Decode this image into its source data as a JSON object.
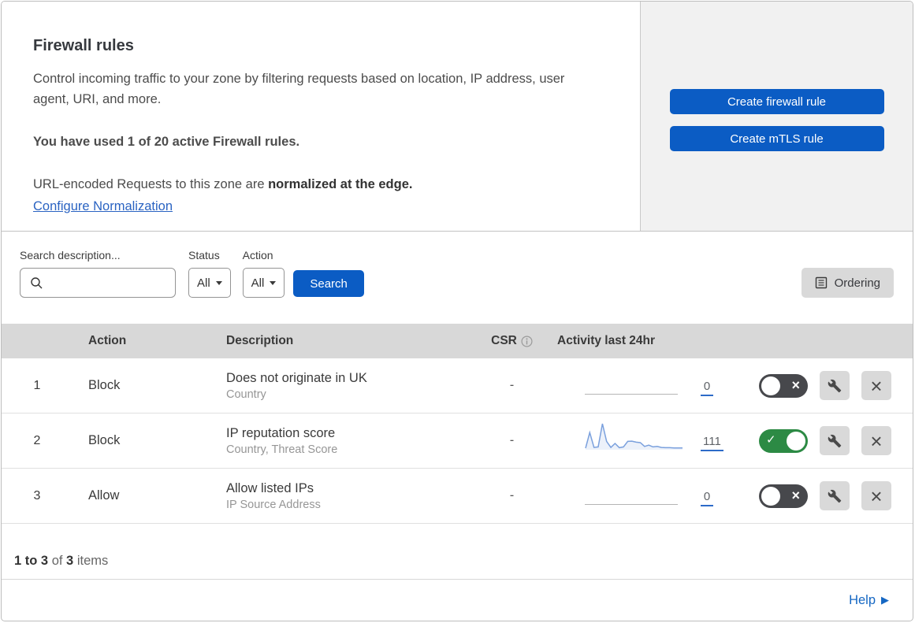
{
  "header": {
    "title": "Firewall rules",
    "description": "Control incoming traffic to your zone by filtering requests based on location, IP address, user agent, URI, and more.",
    "usage_statement": "You have used 1 of 20 active Firewall rules.",
    "normalization_text": "URL-encoded Requests to this zone are ",
    "normalization_bold": "normalized at the edge.",
    "normalization_link": "Configure Normalization",
    "create_firewall_button": "Create firewall rule",
    "create_mtls_button": "Create mTLS rule"
  },
  "filters": {
    "search_label": "Search description...",
    "status_label": "Status",
    "status_value": "All",
    "action_label": "Action",
    "action_value": "All",
    "search_button": "Search",
    "ordering_button": "Ordering"
  },
  "table": {
    "headers": {
      "action": "Action",
      "description": "Description",
      "csr": "CSR",
      "activity": "Activity last 24hr"
    },
    "rows": [
      {
        "num": "1",
        "action": "Block",
        "description": "Does not originate in UK",
        "fields": "Country",
        "csr": "-",
        "count": "0",
        "enabled": false,
        "sparkline": null
      },
      {
        "num": "2",
        "action": "Block",
        "description": "IP reputation score",
        "fields": "Country, Threat Score",
        "csr": "-",
        "count": "111",
        "enabled": true,
        "sparkline": [
          3,
          65,
          6,
          8,
          100,
          30,
          6,
          22,
          5,
          8,
          30,
          31,
          27,
          25,
          10,
          15,
          8,
          10,
          6,
          5,
          5,
          4,
          4,
          4
        ]
      },
      {
        "num": "3",
        "action": "Allow",
        "description": "Allow listed IPs",
        "fields": "IP Source Address",
        "csr": "-",
        "count": "0",
        "enabled": false,
        "sparkline": null
      }
    ]
  },
  "chart_data": {
    "type": "line",
    "title": "Activity last 24hr sparkline (rule 2)",
    "x_range_hours": 24,
    "values": [
      3,
      65,
      6,
      8,
      100,
      30,
      6,
      22,
      5,
      8,
      30,
      31,
      27,
      25,
      10,
      15,
      8,
      10,
      6,
      5,
      5,
      4,
      4,
      4
    ],
    "total": 111,
    "grid": false,
    "legend": false
  },
  "footer": {
    "range": "1 to 3",
    "of_text": " of ",
    "total": "3",
    "items_text": " items",
    "help_label": "Help"
  },
  "colors": {
    "accent_blue": "#0b5cc4",
    "link_blue": "#2a63c2",
    "toggle_on_green": "#2c8a44",
    "toggle_off_gray": "#47484c",
    "sparkline_blue": "#7aa0dd",
    "table_header_gray": "#d8d8d8",
    "panel_gray": "#f1f1f1"
  }
}
